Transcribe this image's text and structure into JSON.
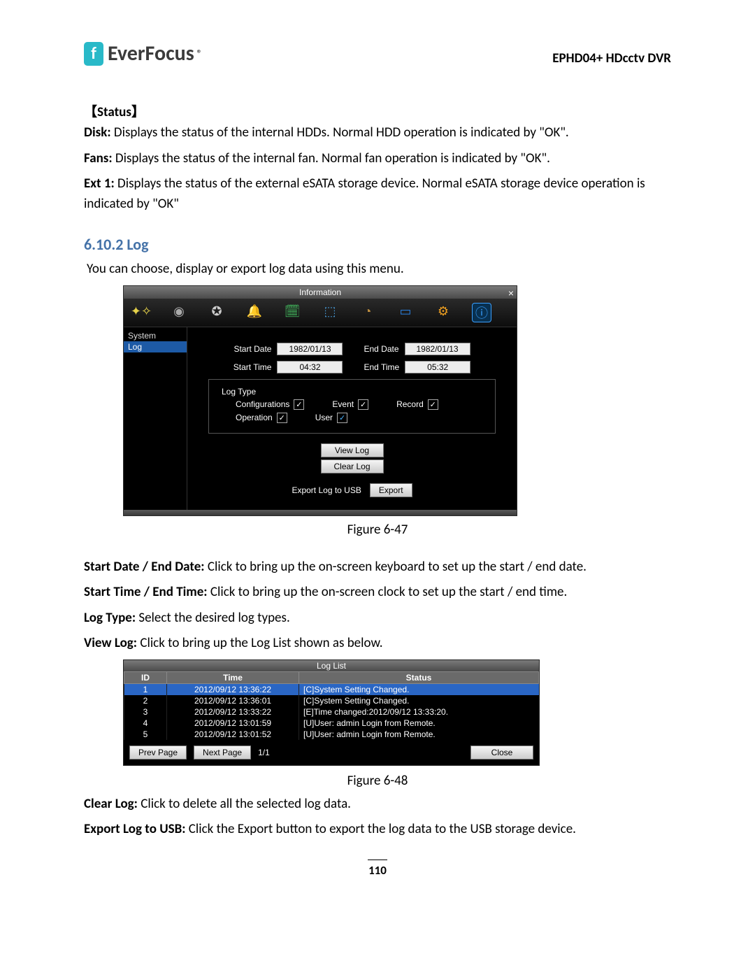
{
  "header": {
    "brand": "EverFocus",
    "brand_mark": "f",
    "trademark": "®",
    "product": "EPHD04+  HDcctv DVR"
  },
  "status": {
    "heading": "【Status】",
    "disk_label": "Disk:",
    "disk_text": " Displays the status of the internal HDDs. Normal HDD operation is indicated by \"OK\".",
    "fans_label": "Fans:",
    "fans_text": " Displays the status of the internal fan. Normal fan operation is indicated by \"OK\".",
    "ext1_label": "Ext 1:",
    "ext1_text": " Displays the status of the external eSATA storage device. Normal eSATA storage device operation is indicated by \"OK\""
  },
  "log": {
    "heading": "6.10.2  Log",
    "intro": "You can choose, display or export log data using this menu."
  },
  "fig47": {
    "title": "Information",
    "sidebar": {
      "items": [
        "System",
        "Log"
      ]
    },
    "start_date_label": "Start Date",
    "start_date": "1982/01/13",
    "end_date_label": "End Date",
    "end_date": "1982/01/13",
    "start_time_label": "Start Time",
    "start_time": "04:32",
    "end_time_label": "End Time",
    "end_time": "05:32",
    "log_type_legend": "Log Type",
    "cb": {
      "configurations": "Configurations",
      "event": "Event",
      "record": "Record",
      "operation": "Operation",
      "user": "User"
    },
    "view_log_btn": "View Log",
    "clear_log_btn": "Clear Log",
    "export_label": "Export Log to USB",
    "export_btn": "Export",
    "caption": "Figure 6-47"
  },
  "desc": {
    "startdate_label": "Start Date / End Date:",
    "startdate_text": " Click to bring up the on-screen keyboard to set up the start / end date.",
    "starttime_label": "Start Time / End Time:",
    "starttime_text": " Click to bring up the on-screen clock to set up the start / end time.",
    "logtype_label": "Log Type:",
    "logtype_text": " Select the desired log types.",
    "viewlog_label": "View Log:",
    "viewlog_text": " Click to bring up the Log List shown as below."
  },
  "fig48": {
    "title": "Log List",
    "columns": [
      "ID",
      "Time",
      "Status"
    ],
    "rows": [
      {
        "id": "1",
        "time": "2012/09/12 13:36:22",
        "status": "[C]System Setting Changed."
      },
      {
        "id": "2",
        "time": "2012/09/12 13:36:01",
        "status": "[C]System Setting Changed."
      },
      {
        "id": "3",
        "time": "2012/09/12 13:33:22",
        "status": "[E]Time changed:2012/09/12 13:33:20."
      },
      {
        "id": "4",
        "time": "2012/09/12 13:01:59",
        "status": "[U]User: admin Login from Remote."
      },
      {
        "id": "5",
        "time": "2012/09/12 13:01:52",
        "status": "[U]User: admin Login from Remote."
      }
    ],
    "prev_btn": "Prev Page",
    "next_btn": "Next Page",
    "page_indicator": "1/1",
    "close_btn": "Close",
    "caption": "Figure 6-48"
  },
  "trailer": {
    "clearlog_label": "Clear Log:",
    "clearlog_text": " Click to delete all the selected log data.",
    "export_label": "Export Log to USB:",
    "export_text": " Click the Export button to export the log data to the USB storage device."
  },
  "page_number": "110",
  "icons": {
    "wand": "✦✧",
    "camera": "📷",
    "reel": "🎞",
    "bell": "🔔",
    "schedule": "📅",
    "network": "⚙",
    "disk": "💽",
    "display": "🖥",
    "settings": "⚙",
    "info": "ℹ"
  }
}
